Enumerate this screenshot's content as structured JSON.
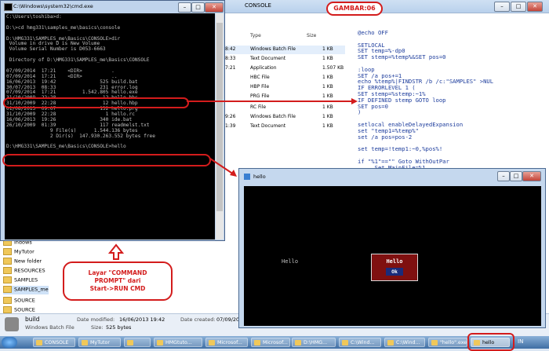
{
  "explorer": {
    "title": "CONSOLE",
    "columns": {
      "type": "Type",
      "size": "Size"
    },
    "files": [
      {
        "time": "8:42",
        "type": "Windows Batch File",
        "size": "1 KB"
      },
      {
        "time": "8:33",
        "type": "Text Document",
        "size": "1 KB"
      },
      {
        "time": "7:21",
        "type": "Application",
        "size": "1.507 KB"
      },
      {
        "time": "",
        "type": "HBC File",
        "size": "1 KB"
      },
      {
        "time": "",
        "type": "HBP File",
        "size": "1 KB"
      },
      {
        "time": "",
        "type": "PRG File",
        "size": "1 KB"
      },
      {
        "time": "",
        "type": "RC File",
        "size": "1 KB"
      },
      {
        "time": "9:26",
        "type": "Windows Batch File",
        "size": "1 KB"
      },
      {
        "time": "1:39",
        "type": "Text Document",
        "size": "1 KB"
      }
    ],
    "nav_items": [
      "indows",
      "MyTutor",
      "New folder",
      "RESOURCES",
      "SAMPLES",
      "SAMPLES_me",
      "SOURCE",
      "SOURCE"
    ],
    "details": {
      "name": "build",
      "type": "Windows Batch File",
      "modified_label": "Date modified:",
      "modified": "16/06/2013 19:42",
      "size_label": "Size:",
      "size": "525 bytes",
      "created_label": "Date created:",
      "created": "07/09/20"
    }
  },
  "gambar_label": "GAMBAR:06",
  "code": "@echo OFF\n\nSETLOCAL\nSET temp=%-dp0\nSET stemp=%temp%&SET pos=0\n\n:loop\nSET /a pos+=1\necho %temp%|FINDSTR /b /c:\"SAMPLES\" >NUL\nIF ERRORLEVEL 1 (\nSET stemp=%stemp:~1%\nIF DEFINED stemp GOTO loop\nSET pos=0\n)\n\nsetlocal enableDelayedExpansion\nset \"temp1=%temp%\"\nset /a pos=pos-2\n\nset temp=!temp1:~0,%pos%!\n\nif \"%1\"==\"\" Goto WithOutPar\n     Set MainFile=%1",
  "cmd": {
    "title": "C:\\Windows\\system32\\cmd.exe",
    "lines": [
      "C:\\Users\\toshiba>d:",
      "",
      "D:\\>cd hmg331\\samples_me\\basics\\console",
      "",
      "D:\\HMG331\\SAMPLES_me\\Basics\\CONSOLE>dir",
      " Volume in drive D is New Volume",
      " Volume Serial Number is D053-6663",
      "",
      " Directory of D:\\HMG331\\SAMPLES_me\\Basics\\CONSOLE",
      "",
      "07/09/2014  17:21    <DIR>          .",
      "07/09/2014  17:21    <DIR>          ..",
      "16/06/2013  19:42               525 build.bat",
      "30/07/2013  08:33               231 error.log",
      "07/09/2014  17:21         1.542.805 hello.exe",
      "31/10/2009  22:28                12 hello.hbc",
      "31/10/2009  22:28                12 hello.hbp",
      "01/08/2013  09:07               132 hello.prg",
      "31/10/2009  22:28                 1 hello.rc",
      "16/06/2013  19:26               340 ide.bat",
      "26/10/2009  01:39               117 readmelst.txt",
      "               9 File(s)      1.544.136 bytes",
      "               2 Dir(s)  147.930.263.552 bytes free",
      "",
      "D:\\HMG331\\SAMPLES_me\\Basics\\CONSOLE>hello",
      ""
    ]
  },
  "hello_window": {
    "title": "hello",
    "text": "Hello",
    "dialog_title": "Hello",
    "ok_label": "Ok"
  },
  "annotation": [
    "Layar \"COMMAND",
    "PROMPT\" dari",
    "Start->RUN CMD"
  ],
  "taskbar": {
    "items": [
      "CONSOLE",
      "MyTutor",
      "",
      "HMGtuto...",
      "Microsof...",
      "Microsof...",
      "D:\\HMG...",
      "C:\\Wind...",
      "C:\\Wind...",
      "\"hello\".exe",
      "hello"
    ],
    "tray": "IN"
  }
}
